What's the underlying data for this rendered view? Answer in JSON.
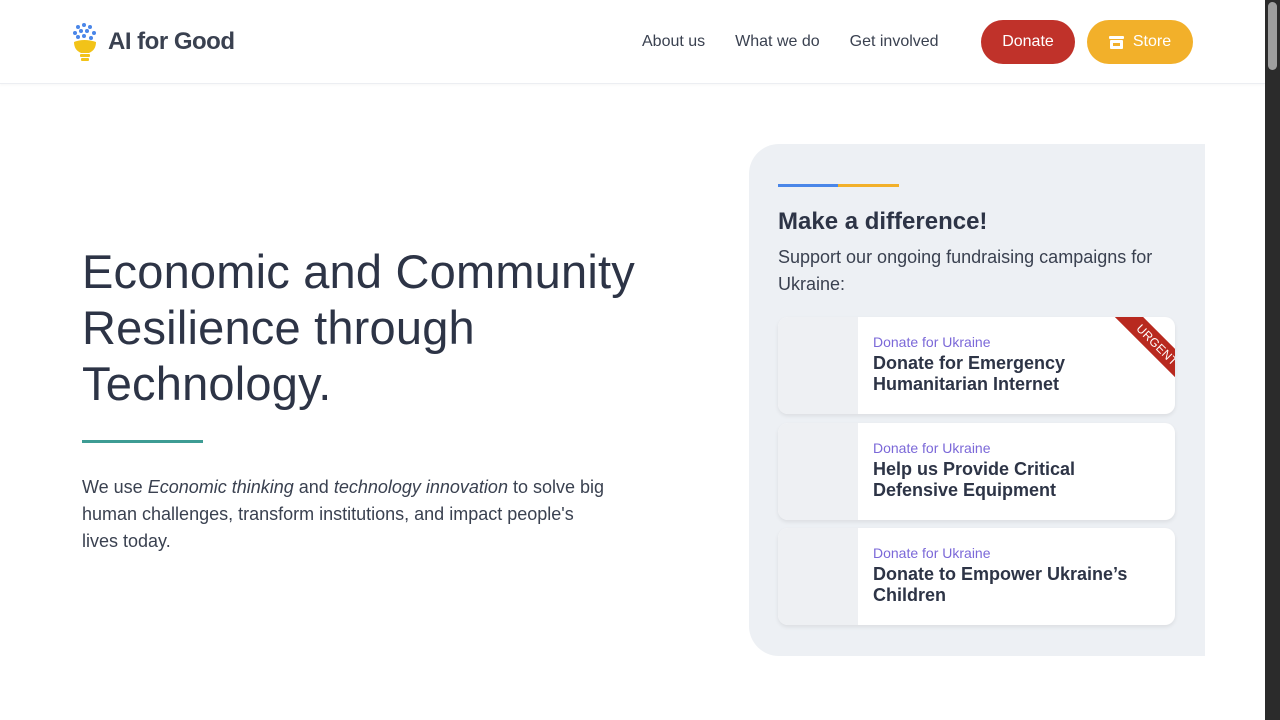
{
  "header": {
    "logo_text": "AI for Good",
    "nav": [
      "About us",
      "What we do",
      "Get involved"
    ],
    "donate_label": "Donate",
    "store_label": "Store"
  },
  "hero": {
    "title": "Economic and Community Resilience through Technology.",
    "text_before": "We use ",
    "em1": "Economic thinking",
    "text_mid": " and ",
    "em2": "technology innovation",
    "text_after": " to solve big human challenges, transform institutions, and impact people's lives today."
  },
  "panel": {
    "title": "Make a difference!",
    "subtitle": "Support our ongoing fundraising campaigns for Ukraine:",
    "cards": [
      {
        "category": "Donate for Ukraine",
        "title": "Donate for Emergency Humanitarian Internet",
        "ribbon": "URGENT"
      },
      {
        "category": "Donate for Ukraine",
        "title": "Help us Provide Critical Defensive Equipment"
      },
      {
        "category": "Donate for Ukraine",
        "title": "Donate to Empower Ukraine’s Children"
      }
    ]
  },
  "colors": {
    "donate": "#c0322a",
    "store": "#f2b02a",
    "accent_teal": "#3d9c94",
    "accent_blue": "#4a86e8",
    "category_purple": "#7b68d8",
    "ribbon": "#b8291f"
  }
}
